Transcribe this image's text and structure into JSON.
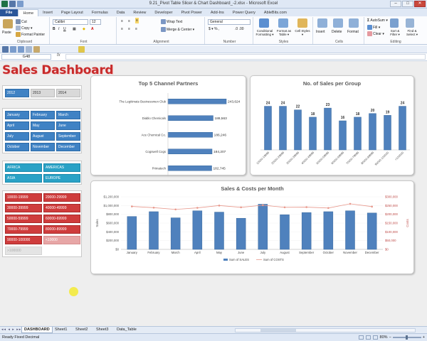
{
  "window": {
    "title": "9.21_Pivot Table Slicer & Chart Dashboard_-2.xlsx - Microsoft Excel",
    "minimize": "–",
    "maximize": "□",
    "close": "✕"
  },
  "ribbon_tabs": [
    "File",
    "Home",
    "Insert",
    "Page Layout",
    "Formulas",
    "Data",
    "Review",
    "Developer",
    "Pivot Power",
    "Add-Ins",
    "Power Query",
    "AbleBits.com"
  ],
  "ribbon": {
    "clipboard": {
      "paste": "Paste",
      "cut": "Cut",
      "copy": "Copy ▾",
      "format_painter": "Format Painter",
      "label": "Clipboard"
    },
    "font": {
      "name": "Calibri",
      "size": "12",
      "label": "Font"
    },
    "alignment": {
      "wrap": "Wrap Text",
      "merge": "Merge & Center ▾",
      "label": "Alignment"
    },
    "number": {
      "format": "General",
      "label": "Number"
    },
    "styles": {
      "conditional": "Conditional Formatting ▾",
      "format_table": "Format as Table ▾",
      "cell_styles": "Cell Styles ▾",
      "label": "Styles"
    },
    "cells": {
      "insert": "Insert",
      "delete": "Delete",
      "format": "Format",
      "label": "Cells"
    },
    "editing": {
      "autosum": "AutoSum ▾",
      "fill": "Fill ▾",
      "clear": "Clear ▾",
      "sort": "Sort & Filter ▾",
      "find": "Find & Select ▾",
      "label": "Editing"
    }
  },
  "formula_bar": {
    "name_box": "G48",
    "fx": "fx",
    "value": ""
  },
  "dashboard": {
    "title": "Sales Dashboard",
    "years": [
      {
        "label": "2012",
        "selected": true
      },
      {
        "label": "2013",
        "selected": false
      },
      {
        "label": "2014",
        "selected": false
      }
    ],
    "months": [
      "January",
      "February",
      "March",
      "April",
      "May",
      "June",
      "July",
      "August",
      "September",
      "October",
      "November",
      "December"
    ],
    "regions": [
      "AFRICA",
      "AMERICAS",
      "ASIA",
      "EUROPE"
    ],
    "ranges": [
      {
        "label": "10000-19999",
        "state": "selected"
      },
      {
        "label": "20000-29999",
        "state": "selected"
      },
      {
        "label": "30000-39999",
        "state": "selected"
      },
      {
        "label": "40000-49999",
        "state": "selected"
      },
      {
        "label": "50000-59999",
        "state": "selected"
      },
      {
        "label": "60000-69999",
        "state": "selected"
      },
      {
        "label": "70000-79999",
        "state": "selected"
      },
      {
        "label": "80000-89999",
        "state": "selected"
      },
      {
        "label": "90000-100000",
        "state": "selected"
      },
      {
        "label": "<10000",
        "state": "nodata"
      },
      {
        "label": ">100000",
        "state": "disabled"
      }
    ]
  },
  "chart_data": [
    {
      "type": "bar",
      "title": "Top 5 Channel Partners",
      "orientation": "horizontal",
      "categories": [
        "The Legitimate Businessmen Club",
        "Diablo Chemicals",
        "Ace Chemical Co.",
        "Cogswell Cogs",
        "Primatech"
      ],
      "values": [
        243624,
        188563,
        186246,
        184207,
        182745
      ],
      "value_labels": [
        "243,624",
        "188,563",
        "186,246",
        "184,207",
        "182,745"
      ],
      "colors": {
        "bar": "#4f81bd"
      }
    },
    {
      "type": "bar",
      "title": "No. of Sales per Group",
      "categories": [
        "10000-19999",
        "20000-29999",
        "30000-39999",
        "40000-49999",
        "50000-59999",
        "60000-69999",
        "70000-79999",
        "80000-89999",
        "90000-100000",
        ">100000"
      ],
      "values": [
        24,
        24,
        22,
        18,
        23,
        16,
        18,
        20,
        19,
        24
      ],
      "colors": {
        "bar": "#4f81bd"
      }
    },
    {
      "type": "bar",
      "title": "Sales & Costs per Month",
      "categories": [
        "January",
        "February",
        "March",
        "April",
        "May",
        "June",
        "July",
        "August",
        "September",
        "October",
        "November",
        "December"
      ],
      "series": [
        {
          "name": "Sum of SALES",
          "type": "bar",
          "axis": "left",
          "values": [
            750000,
            860000,
            720000,
            880000,
            850000,
            710000,
            1030000,
            790000,
            840000,
            860000,
            880000,
            830000
          ],
          "color": "#4f81bd"
        },
        {
          "name": "Sum of COSTS",
          "type": "line",
          "axis": "right",
          "values": [
            245000,
            238000,
            228000,
            237000,
            250000,
            240000,
            252000,
            240000,
            241000,
            236000,
            260000,
            244000
          ],
          "color": "#e8998d"
        }
      ],
      "ylabel": "Sales",
      "y2label": "Costs",
      "left_ticks": [
        "$0",
        "$200,000",
        "$400,000",
        "$600,000",
        "$800,000",
        "$1,000,000",
        "$1,200,000"
      ],
      "right_ticks": [
        "$0",
        "$50,000",
        "$100,000",
        "$150,000",
        "$200,000",
        "$250,000",
        "$300,000"
      ],
      "ylim": [
        0,
        1200000
      ],
      "y2lim": [
        0,
        300000
      ],
      "legend": "bottom"
    }
  ],
  "sheet_tabs": [
    "DASHBOARD",
    "Sheet1",
    "Sheet2",
    "Sheet3",
    "Data_Table"
  ],
  "status": {
    "left": "Ready   Fixed Decimal",
    "zoom": "80%"
  }
}
